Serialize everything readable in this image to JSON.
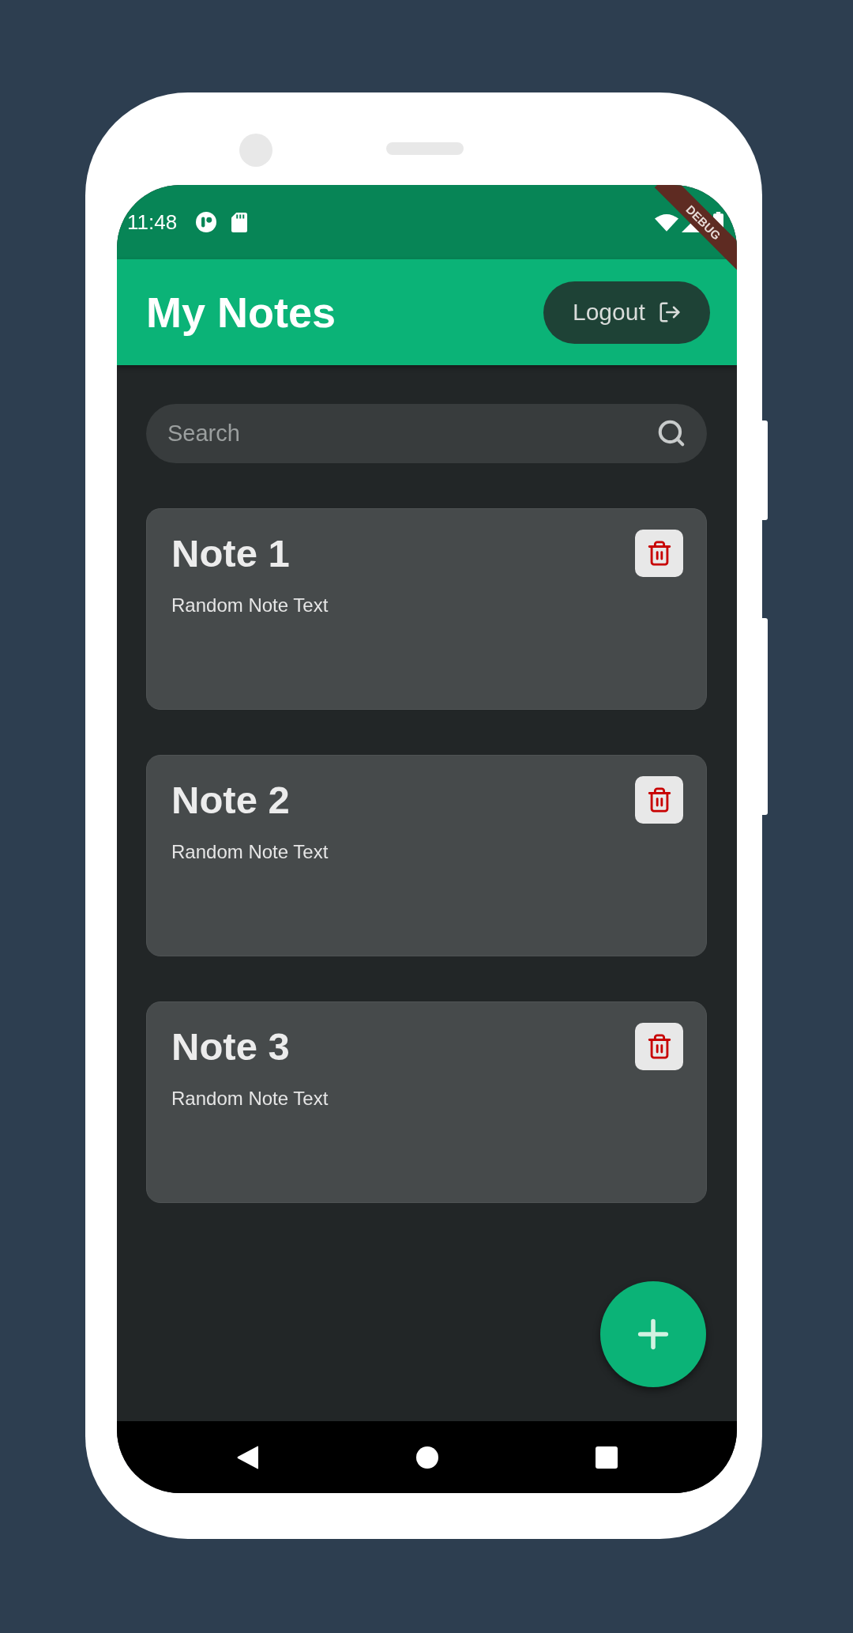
{
  "status_bar": {
    "time": "11:48"
  },
  "debug_banner": {
    "label": "DEBUG"
  },
  "app_bar": {
    "title": "My Notes",
    "logout_button": {
      "label": "Logout"
    }
  },
  "search": {
    "placeholder": "Search"
  },
  "notes": [
    {
      "title": "Note 1",
      "text": "Random Note Text"
    },
    {
      "title": "Note 2",
      "text": "Random Note Text"
    },
    {
      "title": "Note 3",
      "text": "Random Note Text"
    }
  ]
}
